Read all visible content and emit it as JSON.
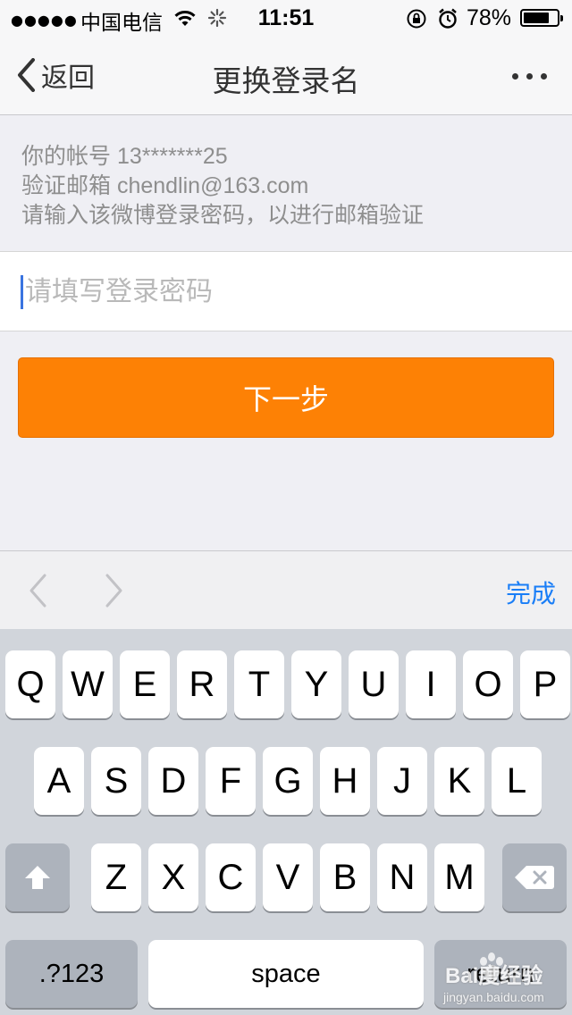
{
  "status_bar": {
    "signal_dots": "●●●●●",
    "carrier": "中国电信",
    "time": "11:51",
    "battery_percent": "78%",
    "battery_level": 0.78,
    "icons": [
      "wifi-icon",
      "activity-spinner-icon",
      "rotation-lock-icon",
      "alarm-icon",
      "battery-icon"
    ]
  },
  "nav": {
    "back_label": "返回",
    "title": "更换登录名",
    "more_icon": "ellipsis-icon"
  },
  "info": {
    "account_line": "你的帐号 13*******25",
    "email_line": "验证邮箱 chendlin@163.com",
    "instruction_line": "请输入该微博登录密码，以进行邮箱验证"
  },
  "password_input": {
    "placeholder": "请填写登录密码",
    "value": ""
  },
  "next_button": {
    "label": "下一步"
  },
  "accessory_bar": {
    "prev_icon": "chevron-left-icon",
    "next_icon": "chevron-right-icon",
    "done_label": "完成"
  },
  "keyboard": {
    "row1": [
      "Q",
      "W",
      "E",
      "R",
      "T",
      "Y",
      "U",
      "I",
      "O",
      "P"
    ],
    "row2": [
      "A",
      "S",
      "D",
      "F",
      "G",
      "H",
      "J",
      "K",
      "L"
    ],
    "row3": [
      "Z",
      "X",
      "C",
      "V",
      "B",
      "N",
      "M"
    ],
    "numbers_label": ".?123",
    "space_label": "space",
    "return_label": "return"
  },
  "watermark": {
    "brand": "Bai度经验",
    "url": "jingyan.baidu.com"
  },
  "colors": {
    "accent_orange": "#fd8105",
    "link_blue": "#1a7ef7",
    "cursor_blue": "#3a74e0"
  }
}
